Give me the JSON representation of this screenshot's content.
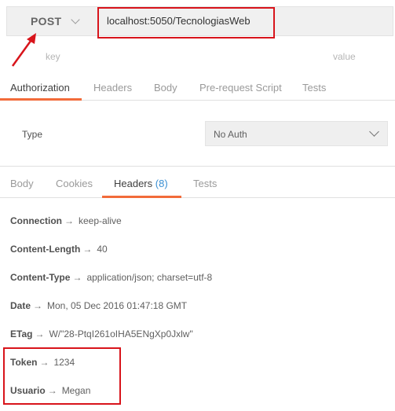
{
  "request": {
    "method": "POST",
    "url": "localhost:5050/TecnologiasWeb"
  },
  "params": {
    "key_placeholder": "key",
    "value_placeholder": "value"
  },
  "request_tabs": [
    {
      "label": "Authorization"
    },
    {
      "label": "Headers"
    },
    {
      "label": "Body"
    },
    {
      "label": "Pre-request Script"
    },
    {
      "label": "Tests"
    }
  ],
  "auth": {
    "type_label": "Type",
    "selected": "No Auth"
  },
  "response_tabs": [
    {
      "label": "Body"
    },
    {
      "label": "Cookies"
    },
    {
      "label": "Headers",
      "count": "(8)"
    },
    {
      "label": "Tests"
    }
  ],
  "headers": [
    {
      "key": "Connection",
      "value": "keep-alive"
    },
    {
      "key": "Content-Length",
      "value": "40"
    },
    {
      "key": "Content-Type",
      "value": "application/json; charset=utf-8"
    },
    {
      "key": "Date",
      "value": "Mon, 05 Dec 2016 01:47:18 GMT"
    },
    {
      "key": "ETag",
      "value": "W/\"28-PtqI261oIHA5ENgXp0Jxlw\""
    },
    {
      "key": "Token",
      "value": "1234"
    },
    {
      "key": "Usuario",
      "value": "Megan"
    }
  ],
  "arrow_symbol": "→",
  "colors": {
    "accent": "#f26b3a",
    "highlight": "#d8141b",
    "count": "#3a8fd3"
  }
}
